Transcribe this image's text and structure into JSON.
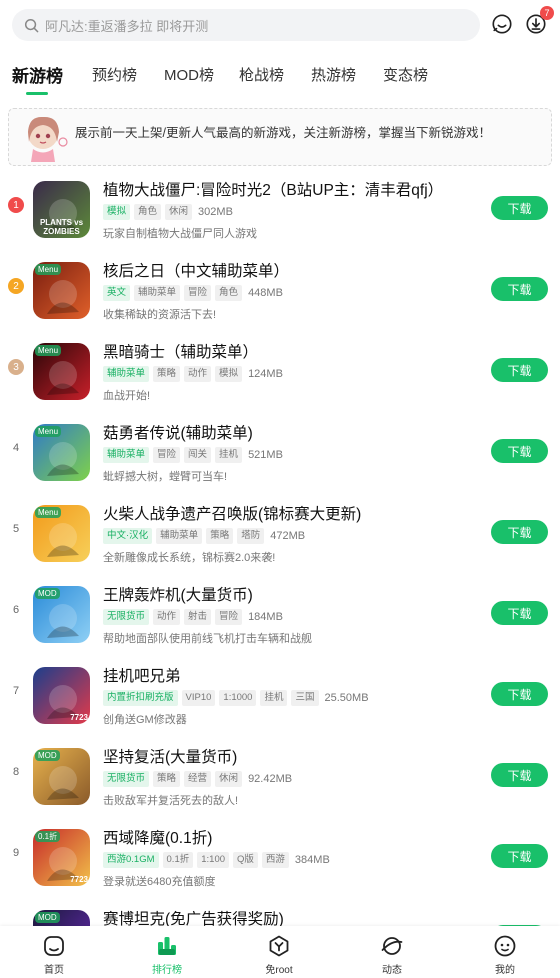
{
  "search": {
    "placeholder": "阿凡达:重返潘多拉 即将开测",
    "icon": "search-icon"
  },
  "header": {
    "download_badge": "7"
  },
  "tabs": [
    {
      "label": "新游榜",
      "active": true
    },
    {
      "label": "预约榜"
    },
    {
      "label": "MOD榜"
    },
    {
      "label": "枪战榜"
    },
    {
      "label": "热游榜"
    },
    {
      "label": "变态榜"
    }
  ],
  "banner": {
    "text": "展示前一天上架/更新人气最高的新游戏，关注新游榜，掌握当下新锐游戏！"
  },
  "colors": {
    "accent": "#19c06a",
    "rank1": "#f04b4b",
    "rank2": "#f5a623",
    "rank3": "#d9b08c"
  },
  "games": [
    {
      "rank": "1",
      "title": "植物大战僵尸:冒险时光2（B站UP主：清丰君qfj）",
      "tags": [
        {
          "t": "模拟",
          "hl": true
        },
        {
          "t": "角色"
        },
        {
          "t": "休闲"
        }
      ],
      "size": "302MB",
      "desc": "玩家自制植物大战僵尸同人游戏",
      "download": "下载"
    },
    {
      "rank": "2",
      "title": "核后之日（中文辅助菜单）",
      "tags": [
        {
          "t": "英文",
          "hl": true
        },
        {
          "t": "辅助菜单"
        },
        {
          "t": "冒险"
        },
        {
          "t": "角色"
        }
      ],
      "size": "448MB",
      "desc": "收集稀缺的资源活下去!",
      "download": "下载"
    },
    {
      "rank": "3",
      "title": "黑暗骑士（辅助菜单）",
      "tags": [
        {
          "t": "辅助菜单",
          "hl": true
        },
        {
          "t": "策略"
        },
        {
          "t": "动作"
        },
        {
          "t": "模拟"
        }
      ],
      "size": "124MB",
      "desc": "血战开始!",
      "download": "下载"
    },
    {
      "rank": "4",
      "title": "菇勇者传说(辅助菜单)",
      "tags": [
        {
          "t": "辅助菜单",
          "hl": true
        },
        {
          "t": "冒险"
        },
        {
          "t": "闯关"
        },
        {
          "t": "挂机"
        }
      ],
      "size": "521MB",
      "desc": "蚍蜉撼大树，螳臂可当车!",
      "download": "下载"
    },
    {
      "rank": "5",
      "title": "火柴人战争遗产召唤版(锦标赛大更新)",
      "tags": [
        {
          "t": "中文·汉化",
          "hl": true
        },
        {
          "t": "辅助菜单"
        },
        {
          "t": "策略"
        },
        {
          "t": "塔防"
        }
      ],
      "size": "472MB",
      "desc": "全新雕像成长系统，锦标赛2.0来袭!",
      "download": "下载"
    },
    {
      "rank": "6",
      "title": "王牌轰炸机(大量货币)",
      "tags": [
        {
          "t": "无限货币",
          "hl": true
        },
        {
          "t": "动作"
        },
        {
          "t": "射击"
        },
        {
          "t": "冒险"
        }
      ],
      "size": "184MB",
      "desc": "帮助地面部队使用前线飞机打击车辆和战舰",
      "download": "下载"
    },
    {
      "rank": "7",
      "title": "挂机吧兄弟",
      "tags": [
        {
          "t": "内置折扣刷充版",
          "hl": true
        },
        {
          "t": "VIP10"
        },
        {
          "t": "1:1000"
        },
        {
          "t": "挂机"
        },
        {
          "t": "三国"
        }
      ],
      "size": "25.50MB",
      "desc": "创角送GM修改器",
      "download": "下载"
    },
    {
      "rank": "8",
      "title": "坚持复活(大量货币)",
      "tags": [
        {
          "t": "无限货币",
          "hl": true
        },
        {
          "t": "策略"
        },
        {
          "t": "经营"
        },
        {
          "t": "休闲"
        }
      ],
      "size": "92.42MB",
      "desc": "击败敌军并复活死去的敌人!",
      "download": "下载"
    },
    {
      "rank": "9",
      "title": "西域降魔(0.1折)",
      "tags": [
        {
          "t": "西游0.1GM",
          "hl": true
        },
        {
          "t": "0.1折"
        },
        {
          "t": "1:100"
        },
        {
          "t": "Q版"
        },
        {
          "t": "西游"
        }
      ],
      "size": "384MB",
      "desc": "登录就送6480充值额度",
      "download": "下载"
    },
    {
      "rank": "",
      "title": "赛博坦克(免广告获得奖励)",
      "tags": [],
      "size": "",
      "desc": "",
      "download": "下载"
    }
  ],
  "thumbs": [
    {
      "icon": "plants-vs-zombies-icon",
      "colors": [
        "#3a2a4a",
        "#5d8a3a"
      ],
      "text": "PLANTS vs ZOMBIES",
      "corner": ""
    },
    {
      "icon": "day-after-icon",
      "colors": [
        "#7a1e10",
        "#e0602a"
      ],
      "text": "",
      "corner": "Menu"
    },
    {
      "icon": "dark-knight-icon",
      "colors": [
        "#2a0608",
        "#c8202a"
      ],
      "text": "",
      "corner": "Menu"
    },
    {
      "icon": "mushroom-hero-icon",
      "colors": [
        "#2f7ac8",
        "#7fd14a"
      ],
      "text": "",
      "corner": "Menu"
    },
    {
      "icon": "stickman-war-icon",
      "colors": [
        "#f29a1a",
        "#f7d05a"
      ],
      "text": "",
      "corner": "Menu"
    },
    {
      "icon": "bomber-plane-icon",
      "colors": [
        "#2a8bd8",
        "#8fd0f5"
      ],
      "text": "",
      "corner": "MOD"
    },
    {
      "icon": "idle-brothers-icon",
      "colors": [
        "#1b3e8c",
        "#e23a4a"
      ],
      "text": "7723",
      "corner": ""
    },
    {
      "icon": "stick-revive-icon",
      "colors": [
        "#e7b24d",
        "#8a5a2a"
      ],
      "text": "",
      "corner": "MOD"
    },
    {
      "icon": "journey-west-icon",
      "colors": [
        "#c62a2a",
        "#f2c14a"
      ],
      "text": "7723",
      "corner": "0.1折"
    },
    {
      "icon": "cyber-tank-icon",
      "colors": [
        "#1a1a3a",
        "#6a2ab8"
      ],
      "text": "",
      "corner": "MOD"
    }
  ],
  "nav": [
    {
      "label": "首页",
      "icon": "home-icon"
    },
    {
      "label": "排行榜",
      "icon": "ranking-icon",
      "active": true
    },
    {
      "label": "免root",
      "icon": "no-root-icon"
    },
    {
      "label": "动态",
      "icon": "planet-icon"
    },
    {
      "label": "我的",
      "icon": "profile-icon"
    }
  ]
}
